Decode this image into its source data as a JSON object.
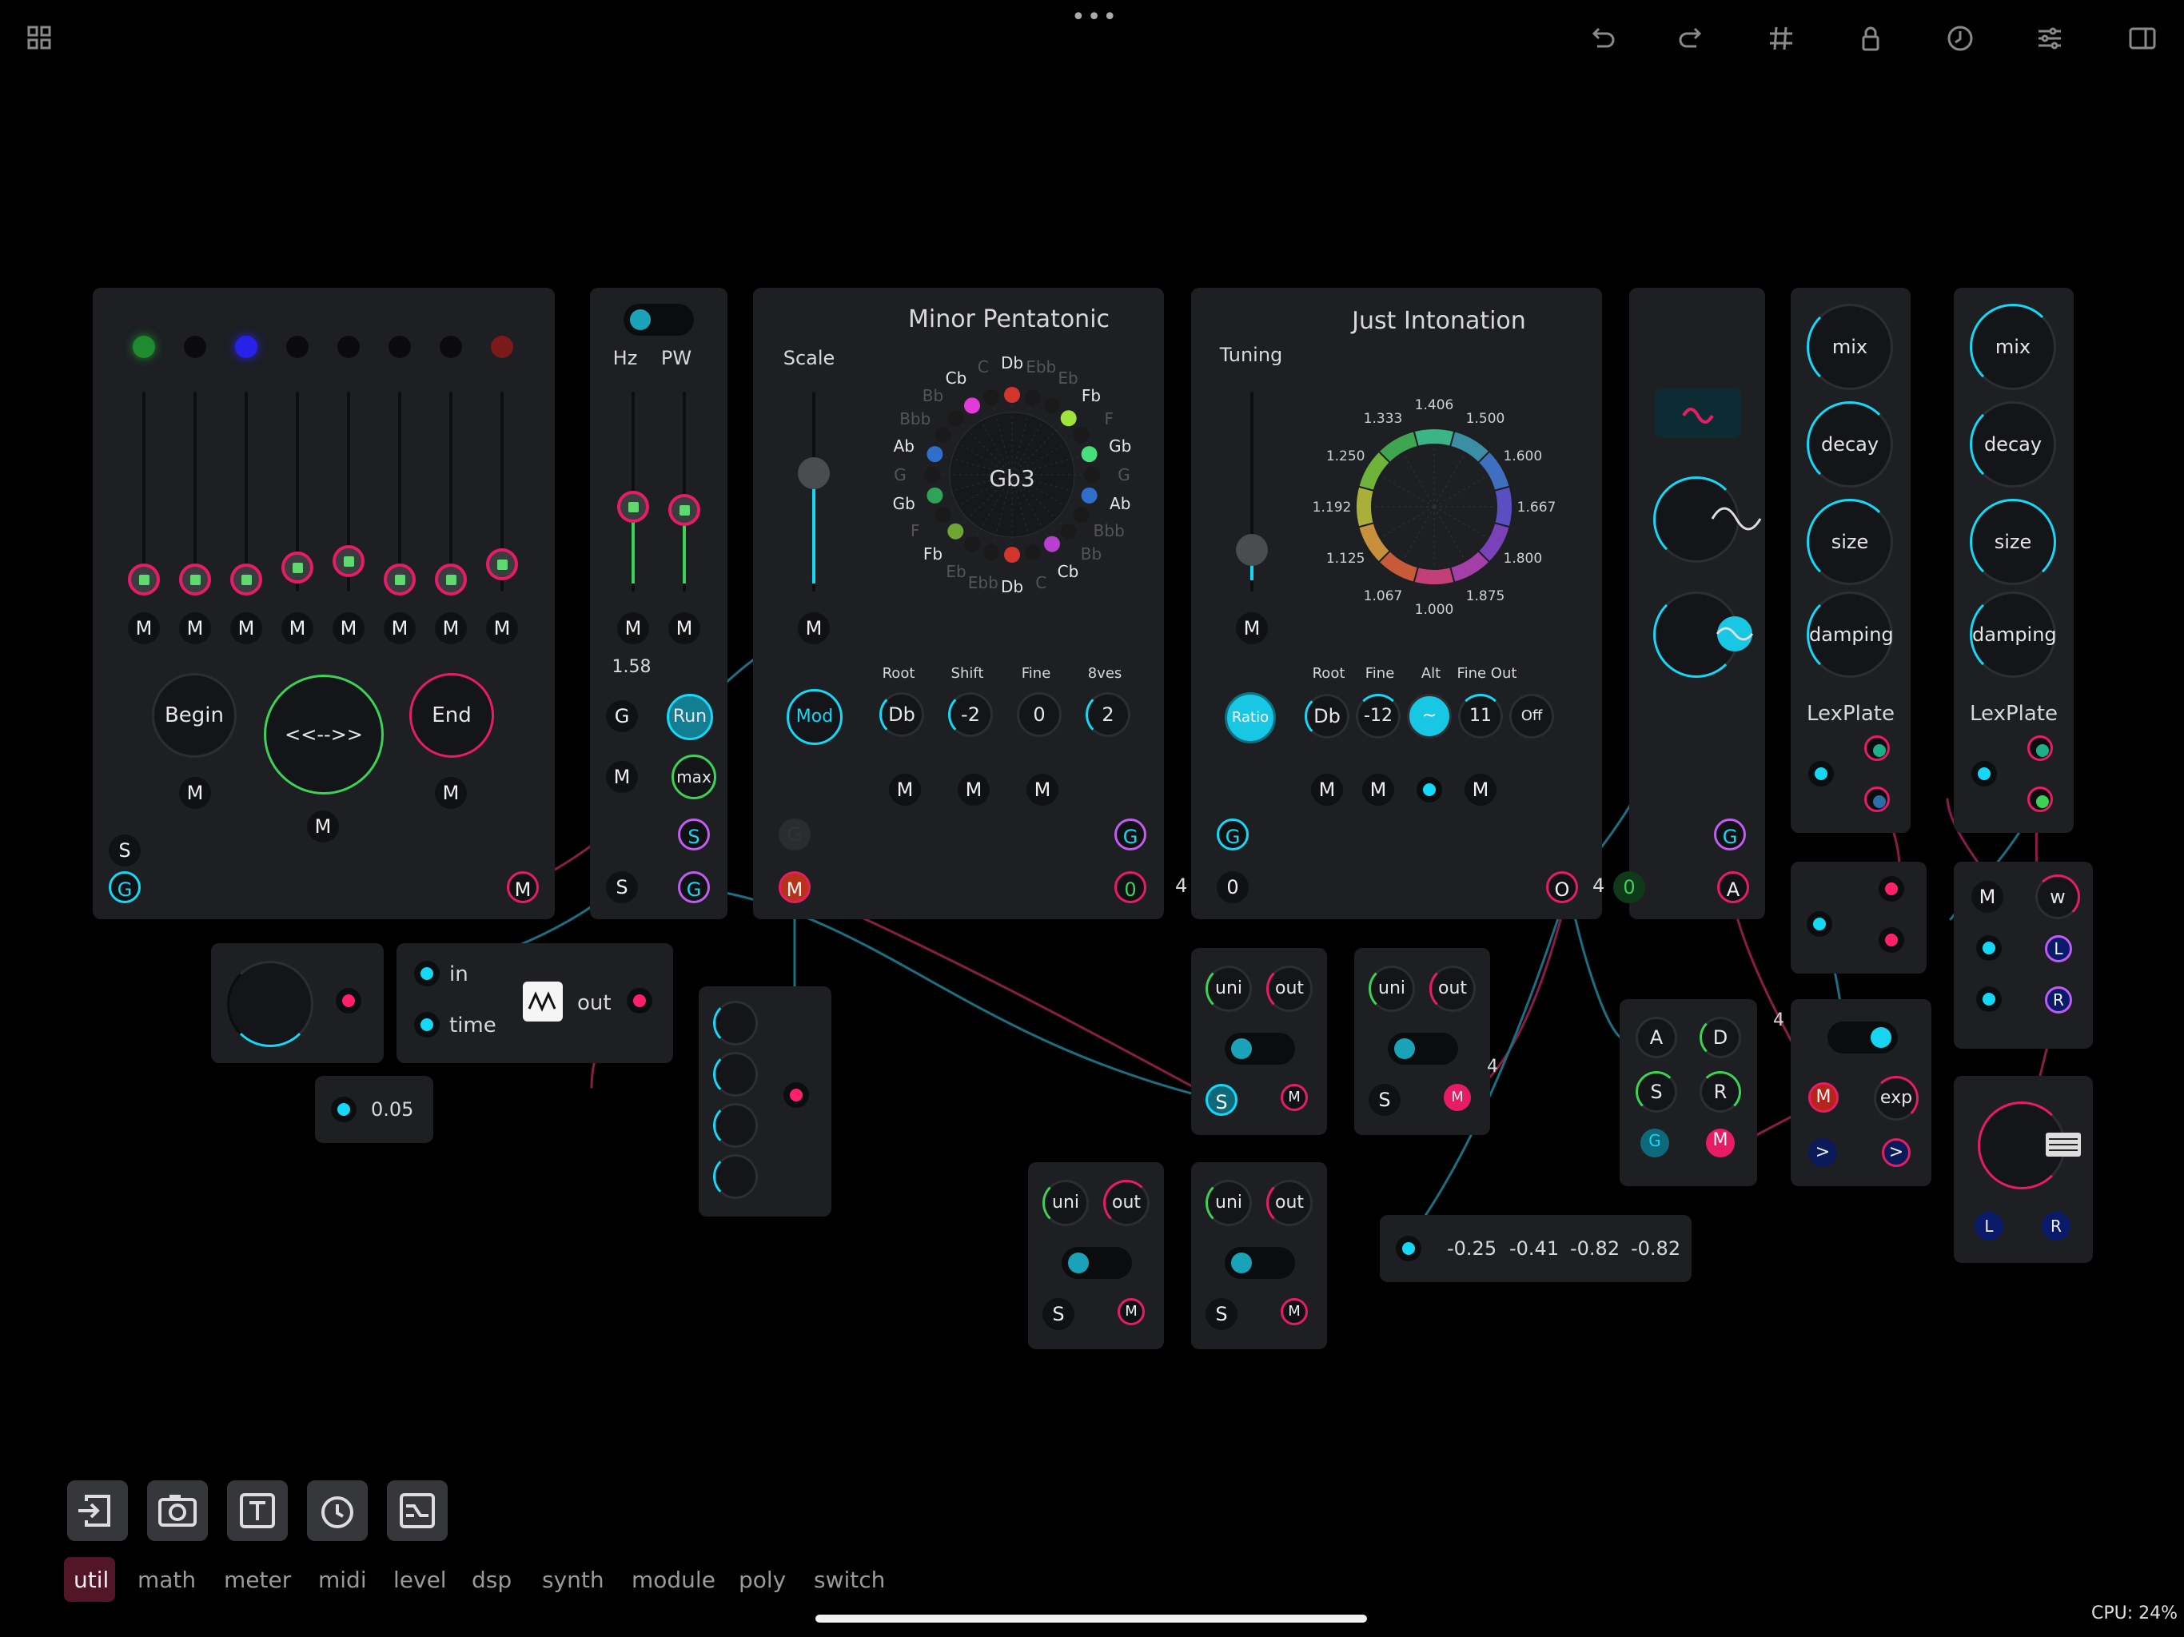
{
  "toolbar": {
    "menu_dots": "•••"
  },
  "categories": [
    "util",
    "math",
    "meter",
    "midi",
    "level",
    "dsp",
    "synth",
    "module",
    "poly",
    "switch"
  ],
  "active_category": "util",
  "cpu": "CPU: 24%",
  "sequencer": {
    "m_labels": [
      "M",
      "M",
      "M",
      "M",
      "M",
      "M",
      "M",
      "M"
    ],
    "begin": "Begin",
    "loop": "<<-->>",
    "end": "End",
    "s": "S",
    "g": "G",
    "m": "M",
    "m2": "M",
    "m3": "M",
    "m4": "M"
  },
  "lfo": {
    "hz": "Hz",
    "pw": "PW",
    "value": "1.58",
    "g": "G",
    "run": "Run",
    "m": "M",
    "max": "max",
    "s": "S",
    "sport": "S",
    "gport": "G",
    "m1": "M",
    "m2": "M"
  },
  "scale": {
    "title": "Minor Pentatonic",
    "scale_label": "Scale",
    "center": "Gb3",
    "notes": [
      "Db",
      "Ebb",
      "Eb",
      "Fb",
      "F",
      "Gb",
      "G",
      "Ab",
      "Bbb",
      "Bb",
      "Cb",
      "C",
      "Db",
      "Ebb",
      "Eb",
      "Fb",
      "F",
      "Gb",
      "G",
      "Ab",
      "Bbb",
      "Bb",
      "Cb",
      "C"
    ],
    "root_label": "Root",
    "shift_label": "Shift",
    "fine_label": "Fine",
    "octaves_label": "8ves",
    "mod": "Mod",
    "root": "Db",
    "shift": "-2",
    "fine": "0",
    "octaves": "2",
    "m": "M",
    "g": "G",
    "m_port": "M",
    "zero_port": "0",
    "four": "4",
    "m1": "M",
    "m2": "M",
    "m3": "M",
    "g2": "G"
  },
  "tuning": {
    "title": "Just Intonation",
    "tuning_label": "Tuning",
    "ratios": [
      "1.406",
      "1.500",
      "1.600",
      "1.667",
      "1.800",
      "1.875",
      "1.000",
      "1.067",
      "1.125",
      "1.192",
      "1.250",
      "1.333"
    ],
    "ratio_btn": "Ratio",
    "root_label": "Root",
    "fine_label": "Fine",
    "alt_label": "Alt",
    "fineout_label": "Fine Out",
    "root": "Db",
    "fine": "-12",
    "alt": "~",
    "fineout": "11",
    "off": "Off",
    "m": "M",
    "g": "G",
    "zero": "0",
    "m1": "M",
    "m2": "M",
    "m3": "M"
  },
  "osc": {
    "g": "G",
    "o": "O",
    "four": "4",
    "zero": "0",
    "a": "A"
  },
  "reverb1": {
    "mix": "mix",
    "decay": "decay",
    "size": "size",
    "damping": "damping",
    "name": "LexPlate"
  },
  "reverb2": {
    "mix": "mix",
    "decay": "decay",
    "size": "size",
    "damping": "damping",
    "name": "LexPlate"
  },
  "delay": {
    "in": "in",
    "time": "time",
    "out": "out",
    "value": "0.05"
  },
  "uni_modules": [
    {
      "uni": "uni",
      "out": "out",
      "s": "S",
      "m": "M"
    },
    {
      "uni": "uni",
      "out": "out",
      "s": "S",
      "m": "M"
    },
    {
      "uni": "uni",
      "out": "out",
      "s": "S",
      "m": "M"
    },
    {
      "uni": "uni",
      "out": "out",
      "s": "S",
      "m": "M"
    }
  ],
  "values_module": {
    "v1": "-0.25",
    "v2": "-0.41",
    "v3": "-0.82",
    "v4": "-0.82"
  },
  "adsr": {
    "a": "A",
    "d": "D",
    "s": "S",
    "r": "R",
    "g": "G",
    "m": "M"
  },
  "exp": {
    "m": "M",
    "exp": "exp",
    "gt": ">",
    "four": "4",
    "four2": "4"
  },
  "mixer": {
    "m": "M",
    "w": "w",
    "l": "L",
    "r": "R",
    "l2": "L",
    "r2": "R"
  },
  "badge4": "4"
}
